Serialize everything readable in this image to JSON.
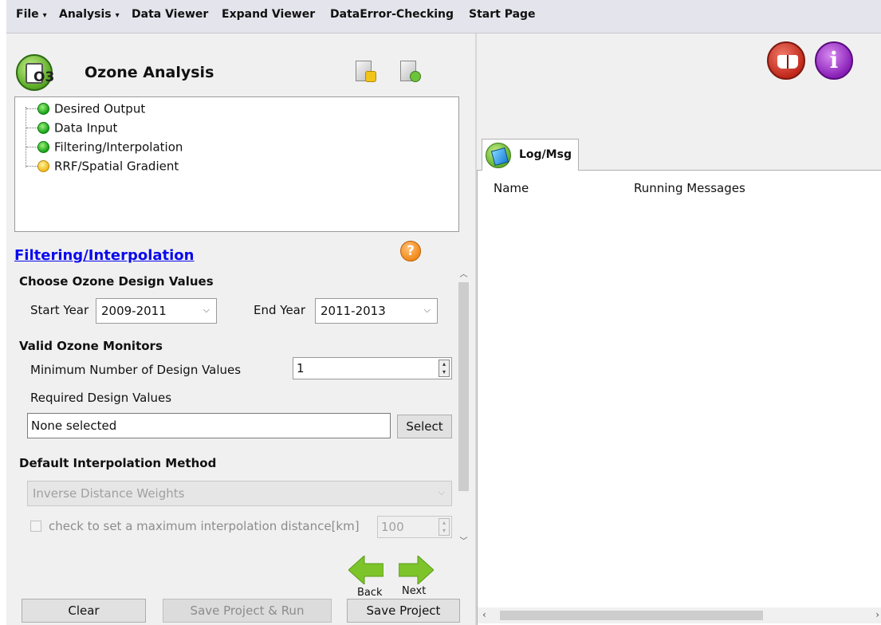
{
  "menu": [
    {
      "label": "File",
      "dropdown": true
    },
    {
      "label": "Analysis",
      "dropdown": true
    },
    {
      "label": "Data Viewer",
      "dropdown": false
    },
    {
      "label": "Expand Viewer",
      "dropdown": false
    },
    {
      "label": "DataError-Checking",
      "dropdown": false
    },
    {
      "label": "Start Page",
      "dropdown": false
    }
  ],
  "app": {
    "title": "Ozone Analysis",
    "logo_text": "O3",
    "tool_icons": [
      "new-project-icon",
      "settings-project-icon"
    ]
  },
  "tree": {
    "items": [
      {
        "label": "Desired Output",
        "status": "green"
      },
      {
        "label": "Data Input",
        "status": "green"
      },
      {
        "label": "Filtering/Interpolation",
        "status": "green"
      },
      {
        "label": "RRF/Spatial Gradient",
        "status": "yellow"
      }
    ]
  },
  "section": {
    "title": "Filtering/Interpolation",
    "help_glyph": "?",
    "design_values": {
      "heading": "Choose Ozone Design Values",
      "start_label": "Start Year",
      "start_value": "2009-2011",
      "end_label": "End Year",
      "end_value": "2011-2013"
    },
    "monitors": {
      "heading": "Valid Ozone Monitors",
      "min_label": "Minimum Number of Design Values",
      "min_value": "1",
      "required_label": "Required Design Values",
      "required_value": "None selected",
      "select_button": "Select"
    },
    "interpolation": {
      "heading": "Default Interpolation Method",
      "method_value": "Inverse Distance Weights",
      "max_distance_label": "check to set a maximum interpolation distance[km]",
      "max_distance_value": "100"
    }
  },
  "nav": {
    "back": "Back",
    "next": "Next"
  },
  "buttons": {
    "clear": "Clear",
    "save_run": "Save Project & Run",
    "save": "Save Project"
  },
  "right": {
    "info_glyph": "i",
    "tab_label": "Log/Msg",
    "columns": [
      "Name",
      "Running Messages"
    ]
  },
  "colors": {
    "link": "#0a0aee",
    "arrow_green": "#7cc42a",
    "status_green": "#16a018",
    "status_yellow": "#f0b818"
  }
}
